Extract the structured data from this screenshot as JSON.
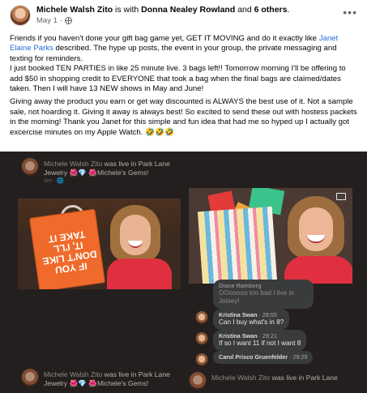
{
  "post": {
    "author": "Michele Walsh Zito",
    "with_text": "is with",
    "tagged": "Donna Nealey Rowland",
    "and_text": "and",
    "others": "6 others",
    "date": "May 1",
    "meta_sep": "·",
    "paragraph1_a": "Friends if you haven't done your gift bag game yet, GET IT MOVING and do it exactly like ",
    "paragraph1_link": "Janet Elaine Parks",
    "paragraph1_b": " described. The hype up posts, the event in your group, the private  messaging and texting for reminders.",
    "paragraph2": "I just booked TEN PARTIES in like 25 minute live. 3 bags left!!  Tomorrow morning I'll be offering to add $50 in shopping credit to EVERYONE that took a bag when the final bags are claimed/dates taken. Then I will have 13 NEW shows in May and June!",
    "paragraph3": "Giving away the product you earn or get way discounted is ALWAYS the best use of it. Not a sample sale, not hoarding it. Giving it away is always best!  So excited to send these out with hostess packets in the morning!  Thank you Janet for this simple and fun idea that had me so hyped up I actually got excercise minutes on my Apple Watch. 🤣🤣🤣"
  },
  "media": {
    "live_author": "Michele Walsh Zito",
    "live_was": "was live in",
    "live_group": "Park Lane",
    "live_group_line2": "Jewelry 🌺💎 🌺Michele's Gems!",
    "live_sub": "1m · 🌐",
    "bag_text": "IF YOU DON'T LIKE IT, I'LL TAKE IT",
    "comments": [
      {
        "name": "Diane Ramberg",
        "time": "",
        "msg": "OOooooo too bad I live in Joisey!",
        "faded": true
      },
      {
        "name": "Kristina Swan",
        "time": "· 28:55",
        "msg": "Can I buy what's in 8?",
        "faded": false
      },
      {
        "name": "Kristina Swan",
        "time": "· 29:21",
        "msg": "If so I want 11 if not I want 8",
        "faded": false
      },
      {
        "name": "Carol Prisco Gruenfelder",
        "time": "· 29:29",
        "msg": "",
        "faded": false
      }
    ]
  }
}
